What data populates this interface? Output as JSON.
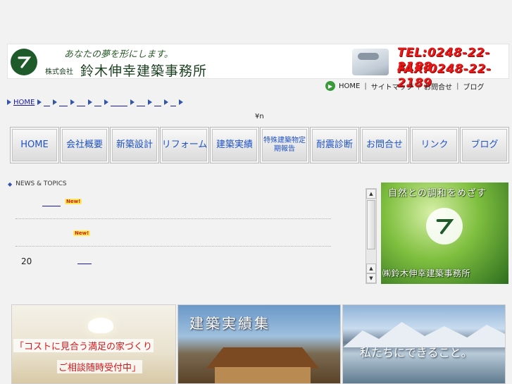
{
  "header": {
    "slogan": "あなたの夢を形にします。",
    "company_prefix": "株式会社",
    "company_name": "鈴木伸幸建築事務所",
    "tel": "TEL:0248-22-2188",
    "fax": "FAX:0248-22-2189",
    "logo_icon": "logo-z-icon",
    "phone_icon": "telephone-image-icon"
  },
  "subnav": {
    "items": [
      "HOME",
      "サイトマップ",
      "お問合せ",
      "ブログ"
    ],
    "separator": "|"
  },
  "breadcrumb": {
    "home": "HOME"
  },
  "yen_text": "¥n",
  "mainnav": {
    "items": [
      "HOME",
      "会社概要",
      "新築設計",
      "リフォーム",
      "建築実績",
      "特殊建築物定期報告",
      "耐震診断",
      "お問合せ",
      "リンク",
      "ブログ"
    ]
  },
  "news": {
    "heading": "NEWS & TOPICS",
    "badge": "New!",
    "year_prefix": "20"
  },
  "promo": {
    "top_text": "自然との調和をめざす",
    "bottom_text": "㈱鈴木伸幸建築事務所"
  },
  "banners": {
    "b1_line1": "「コストに見合う満足の家づくり",
    "b1_line2": "ご相談随時受付中」",
    "b2_title": "建築実績集",
    "b3_title": "私たちにできること。"
  },
  "colors": {
    "brand_green": "#1e5a2a",
    "accent_red": "#e41b1b",
    "link_blue": "#1a1aa6",
    "nav_text_blue": "#1e52c6"
  }
}
